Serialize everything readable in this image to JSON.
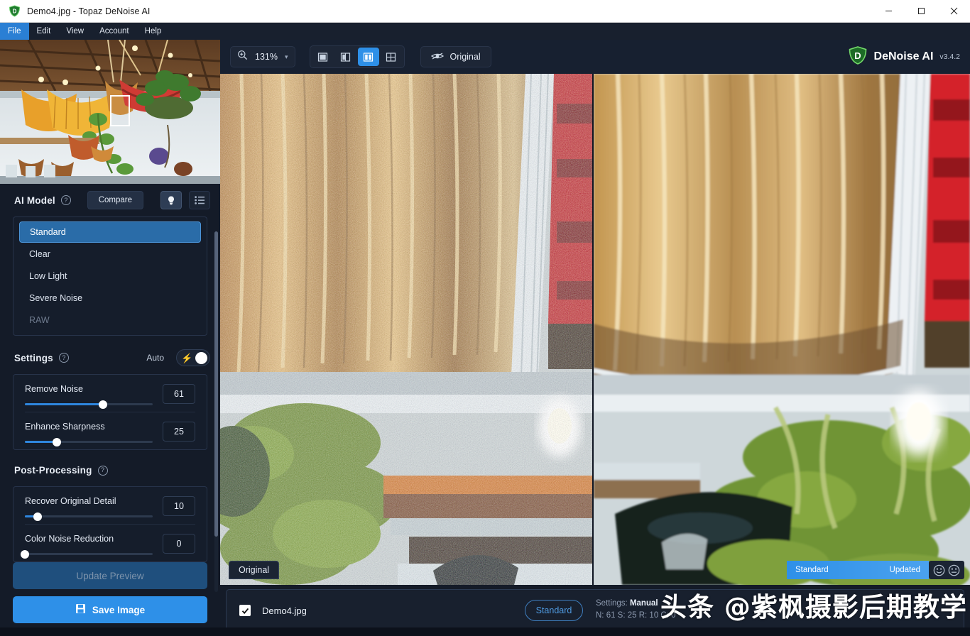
{
  "window": {
    "title": "Demo4.jpg - Topaz DeNoise AI",
    "app_icon": "topaz-shield-icon",
    "minimize": "minimize-icon",
    "maximize": "maximize-icon",
    "close": "close-icon"
  },
  "menu": {
    "items": [
      {
        "label": "File",
        "active": true
      },
      {
        "label": "Edit",
        "active": false
      },
      {
        "label": "View",
        "active": false
      },
      {
        "label": "Account",
        "active": false
      },
      {
        "label": "Help",
        "active": false
      }
    ]
  },
  "toolbar": {
    "zoom_icon": "magnifier-plus-icon",
    "zoom_value": "131%",
    "zoom_dropdown_icon": "chevron-down-icon",
    "view_modes": [
      {
        "name": "single-view",
        "selected": false
      },
      {
        "name": "split-view",
        "selected": false
      },
      {
        "name": "side-by-side-view",
        "selected": true
      },
      {
        "name": "quad-view",
        "selected": false
      }
    ],
    "original_icon": "eye-icon",
    "original_label": "Original",
    "brand_icon": "denoise-logo-icon",
    "brand_name": "DeNoise AI",
    "brand_version": "v3.4.2"
  },
  "sidebar": {
    "ai_model": {
      "title": "AI Model",
      "help_icon": "question-mark-icon",
      "compare_label": "Compare",
      "view_toggle_icons": [
        "lightbulb-icon",
        "list-icon"
      ],
      "models": [
        {
          "label": "Standard",
          "state": "selected"
        },
        {
          "label": "Clear",
          "state": "normal"
        },
        {
          "label": "Low Light",
          "state": "normal"
        },
        {
          "label": "Severe Noise",
          "state": "normal"
        },
        {
          "label": "RAW",
          "state": "disabled"
        }
      ]
    },
    "settings": {
      "title": "Settings",
      "help_icon": "question-mark-icon",
      "auto_label": "Auto",
      "auto_icon": "lightning-bolt-icon",
      "auto_on": true,
      "sliders": [
        {
          "label": "Remove Noise",
          "value": "61",
          "percent": 61
        },
        {
          "label": "Enhance Sharpness",
          "value": "25",
          "percent": 25
        }
      ]
    },
    "post_processing": {
      "title": "Post-Processing",
      "help_icon": "question-mark-icon",
      "sliders": [
        {
          "label": "Recover Original Detail",
          "value": "10",
          "percent": 10
        },
        {
          "label": "Color Noise Reduction",
          "value": "0",
          "percent": 0
        }
      ]
    },
    "actions": {
      "update_preview": "Update Preview",
      "update_preview_enabled": false,
      "save_icon": "floppy-disk-icon",
      "save_image": "Save Image",
      "save_image_enabled": true
    }
  },
  "preview": {
    "left_label": "Original",
    "result_model": "Standard",
    "result_status": "Updated",
    "feedback_icons": [
      "happy-face-icon",
      "sad-face-icon"
    ]
  },
  "filmstrip": {
    "checkbox_checked": true,
    "check_icon": "checkmark-icon",
    "filename": "Demo4.jpg",
    "model_pill": "Standard",
    "settings_prefix": "Settings:",
    "settings_mode": "Manual",
    "params": "N: 61   S: 25   R: 10   C: 0"
  },
  "watermark": {
    "text": "头条 @紫枫摄影后期教学"
  },
  "colors": {
    "accent": "#2e90e8",
    "panel": "#141b28",
    "selected_model": "#2a6ca8",
    "menu_active": "#2a7fd4"
  }
}
